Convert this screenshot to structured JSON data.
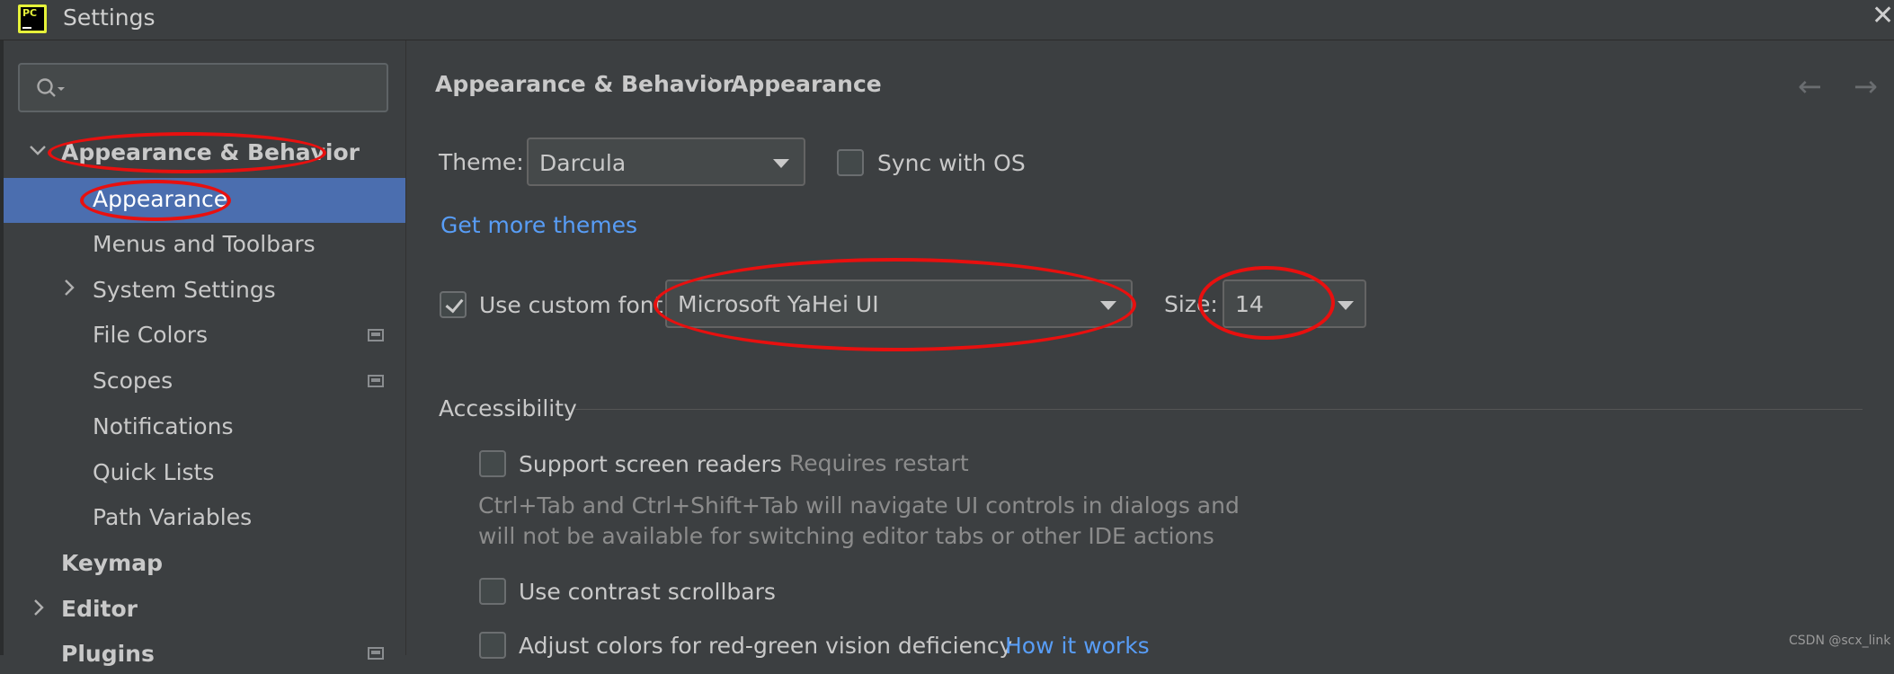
{
  "window": {
    "title": "Settings",
    "close_glyph": "✕",
    "logo_text": "PC"
  },
  "sidebar": {
    "search_placeholder": "",
    "items": [
      {
        "label": "Appearance & Behavior"
      },
      {
        "label": "Appearance"
      },
      {
        "label": "Menus and Toolbars"
      },
      {
        "label": "System Settings"
      },
      {
        "label": "File Colors"
      },
      {
        "label": "Scopes"
      },
      {
        "label": "Notifications"
      },
      {
        "label": "Quick Lists"
      },
      {
        "label": "Path Variables"
      },
      {
        "label": "Keymap"
      },
      {
        "label": "Editor"
      },
      {
        "label": "Plugins"
      }
    ]
  },
  "breadcrumb": {
    "parent": "Appearance & Behavior",
    "separator": "›",
    "current": "Appearance",
    "back_glyph": "←",
    "forward_glyph": "→"
  },
  "main": {
    "theme_label": "Theme:",
    "theme_value": "Darcula",
    "sync_with_os": "Sync with OS",
    "get_more_themes": "Get more themes",
    "use_custom_font": "Use custom font:",
    "font_value": "Microsoft YaHei UI",
    "size_label": "Size:",
    "size_value": "14",
    "accessibility_heading": "Accessibility",
    "support_screen_readers": "Support screen readers",
    "requires_restart": "Requires restart",
    "screen_reader_note_line1": "Ctrl+Tab and Ctrl+Shift+Tab will navigate UI controls in dialogs and",
    "screen_reader_note_line2": "will not be available for switching editor tabs or other IDE actions",
    "use_contrast_scrollbars": "Use contrast scrollbars",
    "adjust_colors": "Adjust colors for red-green vision deficiency",
    "how_it_works": "How it works"
  },
  "states": {
    "sync_with_os_checked": false,
    "use_custom_font_checked": true,
    "support_screen_readers_checked": false,
    "use_contrast_scrollbars_checked": false,
    "adjust_colors_checked": false
  },
  "colors": {
    "background": "#3c3f41",
    "selection": "#4b6eaf",
    "link": "#589df6",
    "annotation_red": "#e8100f"
  },
  "watermark": "CSDN @scx_link"
}
